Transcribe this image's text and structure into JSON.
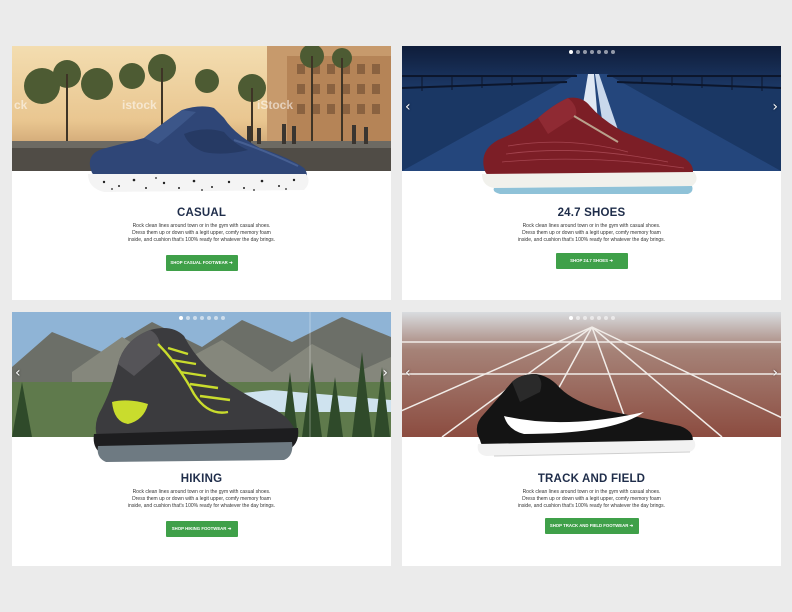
{
  "cards": [
    {
      "title": "CASUAL",
      "description": "Rock clean lines around town or in the gym with casual shoes. Dress them up or down with a legit upper, comfy memory foam inside, and cushion that's 100% ready for whatever the day brings.",
      "cta_label": "SHOP CASUAL FOOTWEAR ➜",
      "watermarks": [
        "ck",
        "istock",
        "iStock"
      ]
    },
    {
      "title": "24.7 SHOES",
      "description": "Rock clean lines around town or in the gym with casual shoes. Dress them up or down with a legit upper, comfy memory foam inside, and cushion that's 100% ready for whatever the day brings.",
      "cta_label": "SHOP 24.7 SHOES ➜",
      "arrows": {
        "left": "‹",
        "right": "›"
      }
    },
    {
      "title": "HIKING",
      "description": "Rock clean lines around town or in the gym with casual shoes. Dress them up or down with a legit upper, comfy memory foam inside, and cushion that's 100% ready for whatever the day brings.",
      "cta_label": "SHOP HIKING FOOTWEAR ➜",
      "arrows": {
        "left": "‹",
        "right": "›"
      }
    },
    {
      "title": "TRACK AND FIELD",
      "description": "Rock clean lines around town or in the gym with casual shoes. Dress them up or down with a legit upper, comfy memory foam inside, and cushion that's 100% ready for whatever the day brings.",
      "cta_label": "SHOP TRACK AND FIELD FOOTWEAR ➜",
      "arrows": {
        "left": "‹",
        "right": "›"
      }
    }
  ],
  "colors": {
    "page_background": "#ebebeb",
    "card_background": "#ffffff",
    "title": "#1f2d4a",
    "cta_green": "#3fa049"
  }
}
